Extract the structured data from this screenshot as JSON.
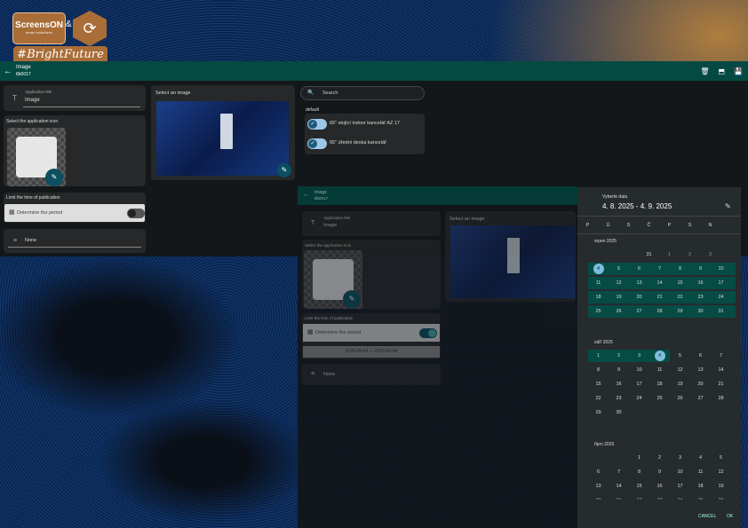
{
  "logo": {
    "brand": "ScreensON",
    "tagline": "smart solutions",
    "amp": "&",
    "hashtag": "#BrightFuture"
  },
  "header": {
    "title": "Image",
    "subtitle": "8b0017",
    "icons": [
      "trash-icon",
      "save-exit-icon",
      "save-icon"
    ]
  },
  "form": {
    "app_title_label": "Application title",
    "app_title_value": "Image",
    "select_icon_label": "Select the application icon",
    "limit_time_label": "Limit the time of publication",
    "determine_period": "Determine the period",
    "none_label": "None",
    "select_image_label": "Select an image"
  },
  "right": {
    "search_placeholder": "Search",
    "group_label": "default",
    "items": [
      "65\" stojící indoor kancelář AZ 17",
      "65\" úřední deska kancelář"
    ]
  },
  "form2": {
    "header_title": "Image",
    "header_sub": "8b0017",
    "period_range": "2025-08-04 — 2025-09-04"
  },
  "datepicker": {
    "title": "Vyberte data",
    "range": "4. 8. 2025 - 4. 9. 2025",
    "weekdays": [
      "P",
      "Ú",
      "S",
      "Č",
      "P",
      "S",
      "N"
    ],
    "month1": "srpen 2025",
    "month2": "září 2025",
    "month3": "říjen 2025",
    "cancel": "CANCEL",
    "ok": "OK"
  },
  "colors": {
    "accent": "#054a42",
    "fab": "#0b4f60",
    "selected": "#7dbcdc"
  }
}
